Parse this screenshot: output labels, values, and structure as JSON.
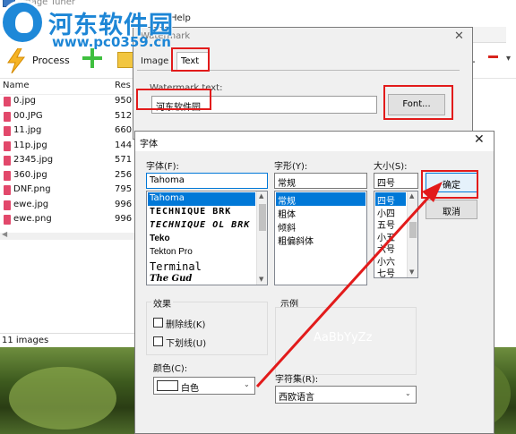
{
  "app": {
    "title": "Image Tuner",
    "menu_help": "Help",
    "process_label": "Process",
    "right_tab_label": "s",
    "columns": {
      "name": "Name",
      "res": "Res"
    },
    "files": [
      {
        "name": "0.jpg",
        "res": "950"
      },
      {
        "name": "00.JPG",
        "res": "512"
      },
      {
        "name": "11.jpg",
        "res": "660"
      },
      {
        "name": "11p.jpg",
        "res": "144"
      },
      {
        "name": "2345.jpg",
        "res": "571"
      },
      {
        "name": "360.jpg",
        "res": "256"
      },
      {
        "name": "DNF.png",
        "res": "795"
      },
      {
        "name": "ewe.jpg",
        "res": "996"
      },
      {
        "name": "ewe.png",
        "res": "996"
      }
    ],
    "status": "11 images"
  },
  "watermark_dialog": {
    "title": "Watermark",
    "tabs": [
      "Image",
      "Text"
    ],
    "active_tab": "Text",
    "text_label": "Watermark text:",
    "text_value": "河东软件园",
    "font_button": "Font..."
  },
  "font_dialog": {
    "title": "字体",
    "font_label": "字体(F):",
    "font_value": "Tahoma",
    "fonts": [
      "Tahoma",
      "TECHNIQUE BRK",
      "TECHNIQUE OL BRK",
      "Teko",
      "Tekton Pro",
      "Terminal",
      "The Gud"
    ],
    "selected_font": "Tahoma",
    "style_label": "字形(Y):",
    "style_value": "常规",
    "styles": [
      "常规",
      "粗体",
      "倾斜",
      "粗偏斜体"
    ],
    "selected_style": "常规",
    "size_label": "大小(S):",
    "size_value": "四号",
    "sizes": [
      "四号",
      "小四",
      "五号",
      "小五",
      "六号",
      "小六",
      "七号"
    ],
    "selected_size": "四号",
    "ok_button": "确定",
    "cancel_button": "取消",
    "effects_label": "效果",
    "strikeout_label": "删除线(K)",
    "underline_label": "下划线(U)",
    "color_label": "颜色(C):",
    "color_value": "白色",
    "sample_label": "示例",
    "sample_text": "AaBbYyZz",
    "charset_label": "字符集(R):",
    "charset_value": "西欧语言"
  },
  "overlay": {
    "logo_text": "河东软件园",
    "logo_url": "www.pc0359.cn"
  },
  "colors": {
    "annotation_red": "#e21b1b",
    "selection_blue": "#0078d7",
    "logo_blue": "#1d86d6"
  }
}
